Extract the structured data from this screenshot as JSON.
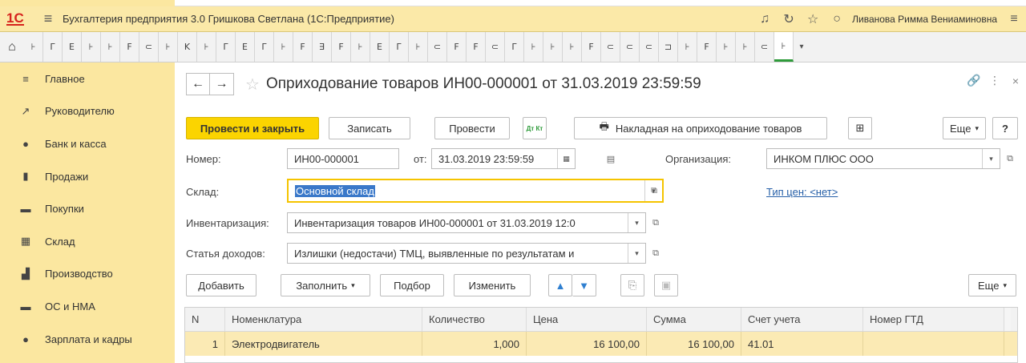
{
  "app": {
    "title": "Бухгалтерия предприятия 3.0 Гришкова Светлана  (1С:Предприятие)",
    "user": "Ливанова Римма Вениаминовна",
    "logo": "1С"
  },
  "tabs": {
    "items": [
      "⊦",
      "Γ",
      "Ε",
      "⊦",
      "⊦",
      "Ϝ",
      "⊂",
      "⊦",
      "Κ",
      "⊦",
      "Γ",
      "Ε",
      "Γ",
      "⊦",
      "Ϝ",
      "∃",
      "F",
      "⊦",
      "Ε",
      "Γ",
      "⊦",
      "⊂",
      "Ϝ",
      "Ϝ",
      "⊂",
      "Γ",
      "⊦",
      "⊦",
      "⊦",
      "Ϝ",
      "⊂",
      "⊂",
      "⊂",
      "⊐",
      "⊦",
      "Ϝ",
      "⊦",
      "⊦",
      "⊂",
      "⊦"
    ]
  },
  "sidebar": {
    "items": [
      {
        "label": "Главное",
        "icon": "≡"
      },
      {
        "label": "Руководителю",
        "icon": "↗"
      },
      {
        "label": "Банк и касса",
        "icon": "●"
      },
      {
        "label": "Продажи",
        "icon": "▮"
      },
      {
        "label": "Покупки",
        "icon": "▬"
      },
      {
        "label": "Склад",
        "icon": "▦"
      },
      {
        "label": "Производство",
        "icon": "▟"
      },
      {
        "label": "ОС и НМА",
        "icon": "▬"
      },
      {
        "label": "Зарплата и кадры",
        "icon": "●"
      }
    ]
  },
  "form": {
    "title": "Оприходование товаров ИН00-000001 от 31.03.2019 23:59:59",
    "toolbar": {
      "post_close": "Провести и закрыть",
      "save": "Записать",
      "post": "Провести",
      "dtkt": "Дт Кт",
      "print": "Накладная на оприходование товаров",
      "more": "Еще",
      "help": "?"
    },
    "number_label": "Номер:",
    "number_value": "ИН00-000001",
    "date_label": "от:",
    "date_value": "31.03.2019 23:59:59",
    "org_label": "Организация:",
    "org_value": "ИНКОМ ПЛЮС ООО",
    "warehouse_label": "Склад:",
    "warehouse_value": "Основной склад",
    "price_type_link": "Тип цен: <нет>",
    "inventory_label": "Инвентаризация:",
    "inventory_value": "Инвентаризация товаров ИН00-000001 от 31.03.2019 12:0",
    "income_label": "Статья доходов:",
    "income_value": "Излишки (недостачи) ТМЦ, выявленные по результатам и",
    "table_toolbar": {
      "add": "Добавить",
      "fill": "Заполнить",
      "pick": "Подбор",
      "change": "Изменить",
      "more": "Еще"
    },
    "table": {
      "columns": [
        "N",
        "Номенклатура",
        "Количество",
        "Цена",
        "Сумма",
        "Счет учета",
        "Номер ГТД"
      ],
      "rows": [
        {
          "n": "1",
          "item": "Электродвигатель",
          "qty": "1,000",
          "price": "16 100,00",
          "sum": "16 100,00",
          "account": "41.01",
          "gtd": ""
        }
      ]
    }
  },
  "colors": {
    "accent": "#fbd400",
    "sidebar": "#fbe7a0",
    "selected_row": "#fbeab4",
    "link": "#2760a8"
  }
}
